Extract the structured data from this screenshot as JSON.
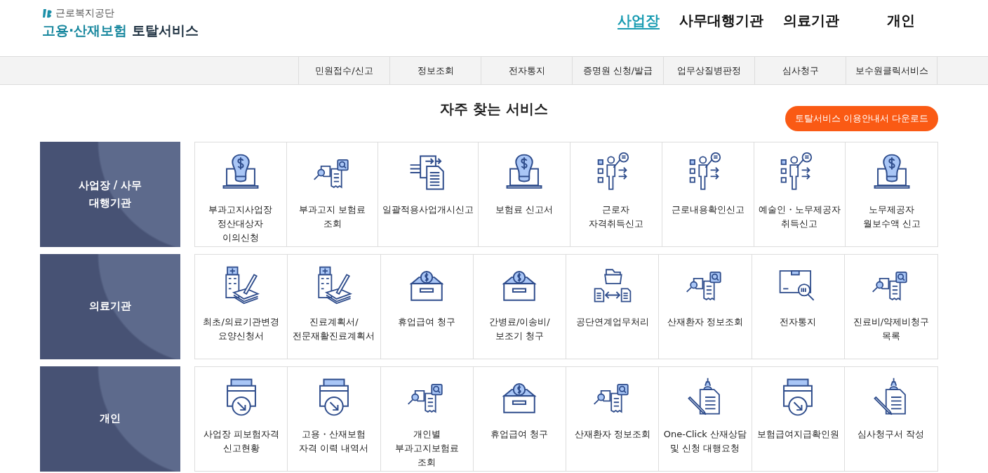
{
  "logo": {
    "org": "근로복지공단",
    "title_main": "고용·산재보험",
    "title_sub": "토탈서비스"
  },
  "main_nav": [
    {
      "label": "사업장",
      "selected": true
    },
    {
      "label": "사무대행기관",
      "selected": false
    },
    {
      "label": "의료기관",
      "selected": false
    },
    {
      "label": "개인",
      "selected": false
    }
  ],
  "sub_nav": [
    "민원접수/신고",
    "정보조회",
    "전자통지",
    "증명원 신청/발급",
    "업무상질병판정",
    "심사청구",
    "보수원클릭서비스"
  ],
  "section_title": "자주 찾는 서비스",
  "download_button": "토탈서비스 이용안내서 다운로드",
  "groups": [
    {
      "label": "사업장 / 사무대행기관",
      "services": [
        {
          "label": "부과고지사업장 정산대상자 이의신청",
          "kind": "bulb"
        },
        {
          "label": "부과고지 보험료 조회",
          "kind": "search"
        },
        {
          "label": "일괄적용사업개시신고",
          "kind": "docs"
        },
        {
          "label": "보험료 신고서",
          "kind": "bulb"
        },
        {
          "label": "근로자 자격취득신고",
          "kind": "presenter"
        },
        {
          "label": "근로내용확인신고",
          "kind": "presenter"
        },
        {
          "label": "예술인・노무제공자 취득신고",
          "kind": "presenter"
        },
        {
          "label": "노무제공자 월보수액 신고",
          "kind": "bulb"
        }
      ]
    },
    {
      "label": "의료기관",
      "services": [
        {
          "label": "최초/의료기관변경 요양신청서",
          "kind": "hospital"
        },
        {
          "label": "진료계획서/전문재활진료계획서",
          "kind": "hospital"
        },
        {
          "label": "휴업급여 청구",
          "kind": "coinbox"
        },
        {
          "label": "간병료/이송비/보조기 청구",
          "kind": "coinbox"
        },
        {
          "label": "공단연계업무처리",
          "kind": "exchange"
        },
        {
          "label": "산재환자 정보조회",
          "kind": "search"
        },
        {
          "label": "전자통지",
          "kind": "parcel"
        },
        {
          "label": "진료비/약제비청구 목록",
          "kind": "search"
        }
      ]
    },
    {
      "label": "개인",
      "services": [
        {
          "label": "사업장 피보험자격 신고현황",
          "kind": "printer"
        },
        {
          "label": "고용・산재보험 자격 이력 내역서",
          "kind": "printer"
        },
        {
          "label": "개인별 부과고지보험료 조회",
          "kind": "search"
        },
        {
          "label": "휴업급여 청구",
          "kind": "coinbox"
        },
        {
          "label": "산재환자 정보조회",
          "kind": "search"
        },
        {
          "label": "One-Click 산재상담 및 신청 대행요청",
          "kind": "pen"
        },
        {
          "label": "보험급여지급확인원",
          "kind": "printer"
        },
        {
          "label": "심사청구서 작성",
          "kind": "pen"
        }
      ]
    }
  ]
}
